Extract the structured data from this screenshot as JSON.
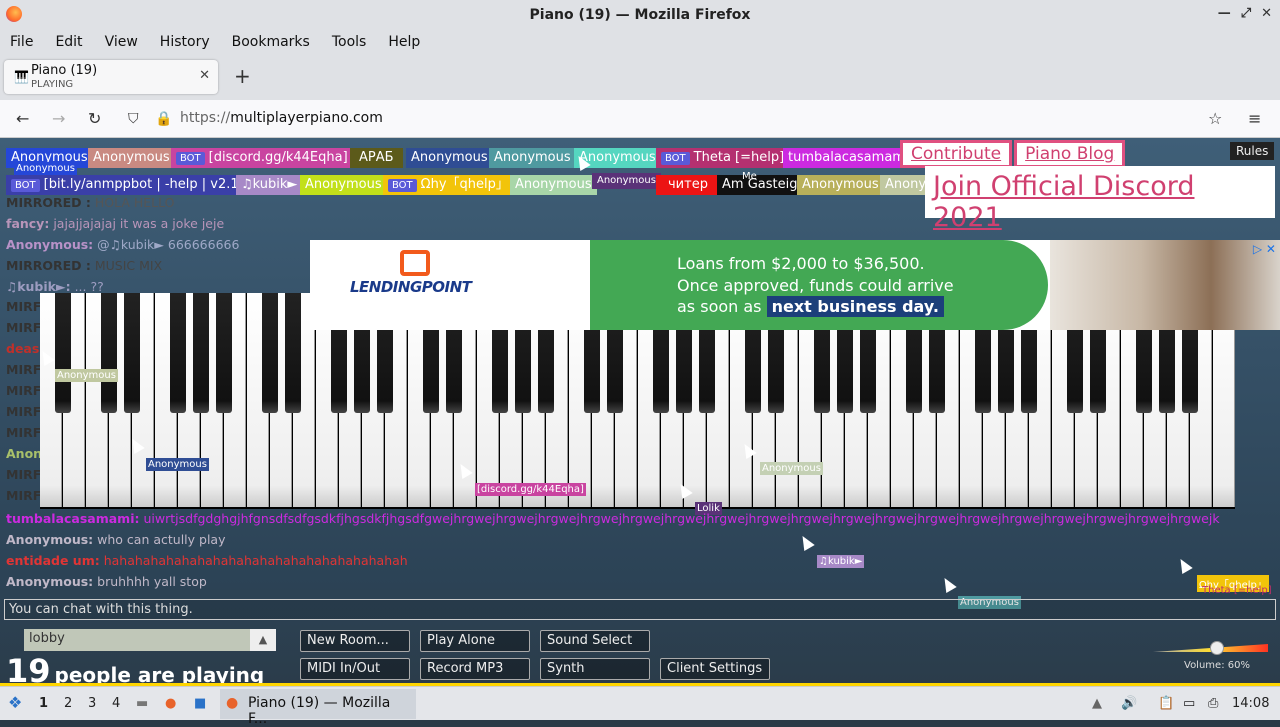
{
  "window": {
    "title": "Piano (19) — Mozilla Firefox"
  },
  "menu": [
    "File",
    "Edit",
    "View",
    "History",
    "Bookmarks",
    "Tools",
    "Help"
  ],
  "tab": {
    "title": "Piano (19)",
    "subtitle": "PLAYING"
  },
  "url": {
    "protocol": "https://",
    "host": "multiplayerpiano.com"
  },
  "players_row1": [
    {
      "name": "Anonymous",
      "color": "#2547d8"
    },
    {
      "name": "Anonymous",
      "color": "#c98a82"
    },
    {
      "name": "[discord.gg/k44Eqha]",
      "color": "#c944a0",
      "bot": true
    },
    {
      "name": "АРАБ",
      "color": "#5c5a1a"
    },
    {
      "name": "Anonymous",
      "color": "#2f4d94"
    },
    {
      "name": "Anonymous",
      "color": "#4f9aa0"
    },
    {
      "name": "Anonymous",
      "color": "#55d6c0"
    },
    {
      "name": "Theta [=help]",
      "color": "#b43070",
      "bot": true
    },
    {
      "name": "tumbalacasamami",
      "color": "#cc2ae0"
    }
  ],
  "players_row2": [
    {
      "name": "[bit.ly/anmppbot | -help | v2.1]",
      "color": "#3a3fa8",
      "bot": true
    },
    {
      "name": "♫kubik►",
      "color": "#a789c7"
    },
    {
      "name": "Anonymous",
      "color": "#c2e01a"
    },
    {
      "name": "Ωhy「qhelp」",
      "color": "#f2c40a",
      "bot": true
    },
    {
      "name": "Anonymous",
      "color": "#a8d6a8"
    },
    {
      "name": "Anonymous",
      "color": "#5a3278"
    },
    {
      "name": "читер",
      "color": "#ec1414"
    },
    {
      "name": "Am Gasteig",
      "color": "#111111"
    },
    {
      "name": "Anonymous",
      "color": "#b8b05a"
    },
    {
      "name": "Anony",
      "color": "#c0c8a0"
    }
  ],
  "bot_label": "BOT",
  "top_links": {
    "contribute": "Contribute",
    "blog": "Piano Blog",
    "discord": "Join Official Discord 2021",
    "rules": "Rules"
  },
  "overlay_tags": {
    "me": "Me",
    "small_anon": "Anonymous"
  },
  "chat_top": [
    {
      "name": "MIRRORED :",
      "text": "HOLA HELLO"
    },
    {
      "name": "fancy:",
      "text": "jajajjajajaj it was a joke jeje"
    },
    {
      "name": "Anonymous:",
      "text": "@♫kubik► 666666666"
    },
    {
      "name": "MIRRORED :",
      "text": "MUSIC MIX"
    },
    {
      "name": "♫kubik►:",
      "text": "... ??"
    }
  ],
  "chat_side": [
    "MIRF",
    "MIRF",
    "deas",
    "MIRF",
    "MIRF",
    "MIRF",
    "MIRF",
    "Anon",
    "MIRF",
    "MIRF"
  ],
  "chat_bottom": [
    {
      "name": "tumbalacasamami:",
      "text": "uiwrtjsdfgdghgjhfgnsdfsdfgsdkfjhgsdkfjhgsdfgwejhrgwejhrgwejhrgwejhrgwejhrgwejhrgwejhrgwejhrgwejhrgwejhrgwejhrgwejhrgwejhrgwejhrgwejhrgwejhrgwejhrgwejhrgwejk"
    },
    {
      "name": "Anonymous:",
      "text": "who can actully play"
    },
    {
      "name": "entidade um:",
      "text": "hahahahahahahahahahahahahahahahahahahah"
    },
    {
      "name": "Anonymous:",
      "text": "bruhhhh yall stop"
    }
  ],
  "ad": {
    "brand": "LENDINGPOINT",
    "line1": "Loans from $2,000 to $36,500.",
    "line2": "Once approved, funds could arrive",
    "line3_pre": "as soon as",
    "line3_cta": "next business day."
  },
  "cursor_tags": [
    {
      "name": "Anonymous"
    },
    {
      "name": "Anonymous"
    },
    {
      "name": "[discord.gg/k44Eqha]"
    },
    {
      "name": "Lolik"
    },
    {
      "name": "Anonymous"
    },
    {
      "name": "♫kubik►"
    },
    {
      "name": "Anonymous"
    },
    {
      "name": "Ωhy「qhelp」"
    },
    {
      "name": "Theta [=help]"
    }
  ],
  "chat_placeholder": "You can chat with this thing.",
  "room": "lobby",
  "people_count": "19",
  "people_label": "people are playing",
  "buttons": {
    "new_room": "New Room...",
    "play_alone": "Play Alone",
    "sound_select": "Sound Select",
    "midi": "MIDI In/Out",
    "record": "Record MP3",
    "synth": "Synth",
    "client_settings": "Client Settings"
  },
  "volume": {
    "label": "Volume: 60%",
    "level": 0.6
  },
  "taskbar": {
    "workspaces": [
      "1",
      "2",
      "3",
      "4"
    ],
    "active_window": "Piano (19) — Mozilla F...",
    "clock": "14:08"
  }
}
